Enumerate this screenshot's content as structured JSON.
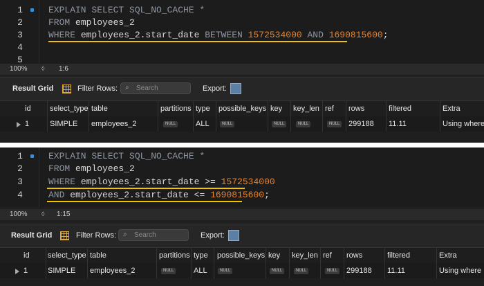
{
  "colors": {
    "keyword": "#8f96a3",
    "text": "#d8d8d8",
    "number": "#e8832e",
    "highlight": "#f3c300",
    "background": "#1f1f1f"
  },
  "panels": [
    {
      "editor": {
        "lines": [
          {
            "num": "1",
            "tokens": [
              {
                "t": "kw",
                "v": "EXPLAIN SELECT SQL_NO_CACHE *"
              }
            ]
          },
          {
            "num": "2",
            "tokens": [
              {
                "t": "kw",
                "v": "FROM "
              },
              {
                "t": "tx",
                "v": "employees_2"
              }
            ]
          },
          {
            "num": "3",
            "tokens": [
              {
                "t": "kw",
                "v": "WHERE "
              },
              {
                "t": "tx",
                "v": "employees_2.start_date "
              },
              {
                "t": "kw",
                "v": "BETWEEN "
              },
              {
                "t": "num",
                "v": "1572534000"
              },
              {
                "t": "kw",
                "v": " AND "
              },
              {
                "t": "num",
                "v": "1690815600"
              },
              {
                "t": "tx",
                "v": ";"
              }
            ]
          },
          {
            "num": "4",
            "tokens": []
          },
          {
            "num": "5",
            "tokens": []
          }
        ]
      },
      "status": {
        "zoom": "100%",
        "cursor": "1:6"
      },
      "toolbar": {
        "result_grid": "Result Grid",
        "filter_rows": "Filter Rows:",
        "search_placeholder": "Search",
        "export": "Export:"
      },
      "table": {
        "columns": [
          "id",
          "select_type",
          "table",
          "partitions",
          "type",
          "possible_keys",
          "key",
          "key_len",
          "ref",
          "rows",
          "filtered",
          "Extra"
        ],
        "rows": [
          [
            "1",
            "SIMPLE",
            "employees_2",
            "NULL",
            "ALL",
            "NULL",
            "NULL",
            "NULL",
            "NULL",
            "299188",
            "11.11",
            "Using where"
          ]
        ]
      }
    },
    {
      "editor": {
        "lines": [
          {
            "num": "1",
            "tokens": [
              {
                "t": "kw",
                "v": "EXPLAIN SELECT SQL_NO_CACHE *"
              }
            ]
          },
          {
            "num": "2",
            "tokens": [
              {
                "t": "kw",
                "v": "FROM "
              },
              {
                "t": "tx",
                "v": "employees_2"
              }
            ]
          },
          {
            "num": "3",
            "tokens": [
              {
                "t": "kw",
                "v": "WHERE "
              },
              {
                "t": "tx",
                "v": "employees_2.start_date >= "
              },
              {
                "t": "num",
                "v": "1572534000"
              }
            ]
          },
          {
            "num": "4",
            "tokens": [
              {
                "t": "kw",
                "v": "AND "
              },
              {
                "t": "tx",
                "v": "employees_2.start_date <= "
              },
              {
                "t": "num",
                "v": "1690815600"
              },
              {
                "t": "tx",
                "v": ";"
              }
            ]
          }
        ]
      },
      "status": {
        "zoom": "100%",
        "cursor": "1:15"
      },
      "toolbar": {
        "result_grid": "Result Grid",
        "filter_rows": "Filter Rows:",
        "search_placeholder": "Search",
        "export": "Export:"
      },
      "table": {
        "columns": [
          "id",
          "select_type",
          "table",
          "partitions",
          "type",
          "possible_keys",
          "key",
          "key_len",
          "ref",
          "rows",
          "filtered",
          "Extra"
        ],
        "rows": [
          [
            "1",
            "SIMPLE",
            "employees_2",
            "NULL",
            "ALL",
            "NULL",
            "NULL",
            "NULL",
            "NULL",
            "299188",
            "11.11",
            "Using where"
          ]
        ]
      }
    }
  ]
}
